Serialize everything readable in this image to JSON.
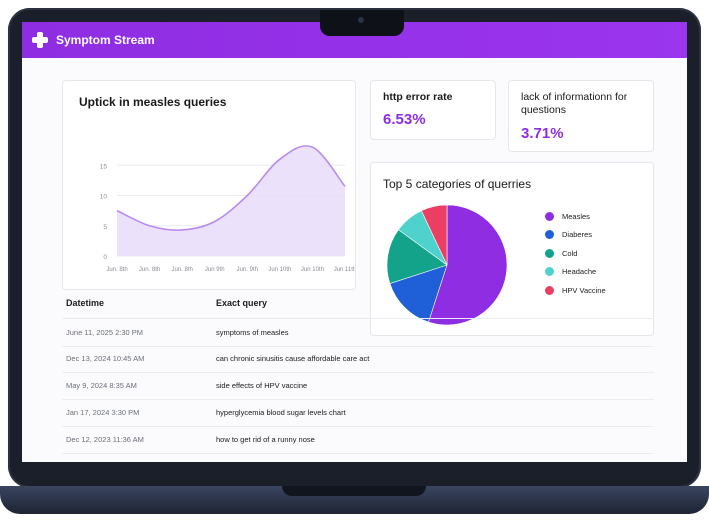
{
  "app": {
    "title": "Symptom Stream"
  },
  "line_chart": {
    "title": "Uptick in measles queries",
    "chart_data": {
      "type": "line",
      "title": "Uptick in measles queries",
      "x": [
        "Jun. 8th",
        "Jun. 8th",
        "Jun. 8th",
        "Jun 9th",
        "Jun. 9th",
        "Jun 10th",
        "Jun 10th",
        "Jun 11th"
      ],
      "ytick_labels": [
        "0",
        "5",
        "10",
        "15"
      ],
      "ylim": [
        0,
        20
      ],
      "series": [
        {
          "values": [
            7.5,
            5,
            4.3,
            5.7,
            10,
            16,
            18,
            11.5
          ]
        }
      ],
      "grid": true,
      "fill": true
    }
  },
  "metrics": [
    {
      "label": "http error rate",
      "value": "6.53%"
    },
    {
      "label": "lack of informationn for questions",
      "value": "3.71%"
    }
  ],
  "pie_chart": {
    "title": "Top 5 categories of querries",
    "chart_data": {
      "type": "pie",
      "title": "Top 5 categories of querries",
      "categories": [
        "Measles",
        "Diaberes",
        "Cold",
        "Headache",
        "HPV Vaccine"
      ],
      "values": [
        55,
        15,
        15,
        8,
        7
      ],
      "colors": [
        "#8e2de2",
        "#1f5fd8",
        "#12a38a",
        "#4fd1cc",
        "#ea3e62"
      ],
      "legend": "right"
    }
  },
  "table": {
    "headers": {
      "datetime": "Datetime",
      "query": "Exact query"
    },
    "rows": [
      {
        "datetime": "June 11, 2025 2:30 PM",
        "query": "symptoms of measles"
      },
      {
        "datetime": "Dec 13, 2024 10:45 AM",
        "query": "can chronic sinusitis cause affordable care act"
      },
      {
        "datetime": "May 9, 2024 8:35 AM",
        "query": "side effects of HPV vaccine"
      },
      {
        "datetime": "Jan 17, 2024 3:30 PM",
        "query": "hyperglycemia blood sugar levels chart"
      },
      {
        "datetime": "Dec 12, 2023 11:36 AM",
        "query": "how to get rid of a runny nose"
      }
    ]
  },
  "colors": {
    "brand": "#8e2de2",
    "line": "#b98cec",
    "fill": "#e9dcfa"
  }
}
